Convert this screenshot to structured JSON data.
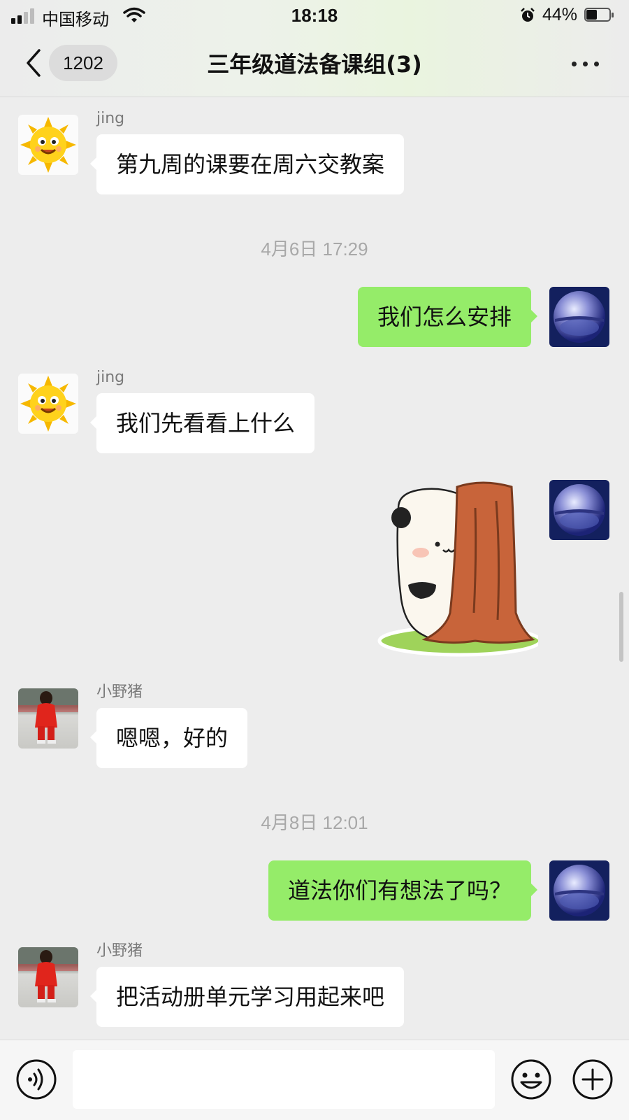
{
  "status_bar": {
    "carrier": "中国移动",
    "time": "18:18",
    "battery": "44%",
    "icons": [
      "signal-icon",
      "wifi-icon",
      "alarm-icon",
      "battery-icon"
    ]
  },
  "nav": {
    "unread_count": "1202",
    "title": "三年级道法备课组(3)",
    "icons": [
      "back-chevron-icon",
      "more-icon"
    ]
  },
  "messages": [
    {
      "type": "text",
      "direction": "in",
      "sender": "jing",
      "avatar": "sun-avatar",
      "text": "第九周的课要在周六交教案"
    },
    {
      "type": "timestamp",
      "text": "4月6日 17:29"
    },
    {
      "type": "text",
      "direction": "out",
      "avatar": "crystal-ball-avatar",
      "text": "我们怎么安排"
    },
    {
      "type": "text",
      "direction": "in",
      "sender": "jing",
      "avatar": "sun-avatar",
      "text": "我们先看看上什么"
    },
    {
      "type": "sticker",
      "direction": "out",
      "avatar": "crystal-ball-avatar",
      "sticker": "panda-peeking-behind-tree-sticker"
    },
    {
      "type": "text",
      "direction": "in",
      "sender": "小野猪",
      "avatar": "child-red-outfit-avatar",
      "text": "嗯嗯，好的"
    },
    {
      "type": "timestamp",
      "text": "4月8日 12:01"
    },
    {
      "type": "text",
      "direction": "out",
      "avatar": "crystal-ball-avatar",
      "text": "道法你们有想法了吗？"
    },
    {
      "type": "text",
      "direction": "in",
      "sender": "小野猪",
      "avatar": "child-red-outfit-avatar",
      "text": "把活动册单元学习用起来吧"
    }
  ],
  "input_bar": {
    "value": "",
    "icons": [
      "voice-icon",
      "emoji-icon",
      "plus-icon"
    ]
  },
  "colors": {
    "outgoing_bubble": "#95ec69",
    "incoming_bubble": "#ffffff",
    "background": "#ededed"
  }
}
